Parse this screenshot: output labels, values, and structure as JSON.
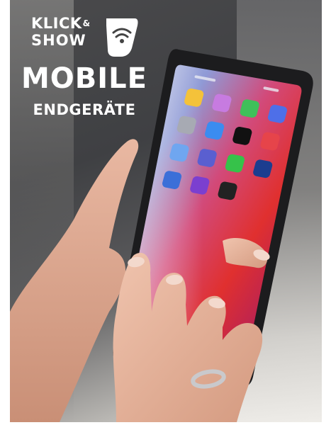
{
  "logo": {
    "line1": "KLICK",
    "ampersand": "&",
    "line2": "SHOW",
    "icon": "wifi-badge-icon"
  },
  "headline": {
    "title": "MOBILE",
    "subtitle": "ENDGERÄTE"
  },
  "colors": {
    "text": "#ffffff",
    "phone_body": "#1c1c1e"
  }
}
